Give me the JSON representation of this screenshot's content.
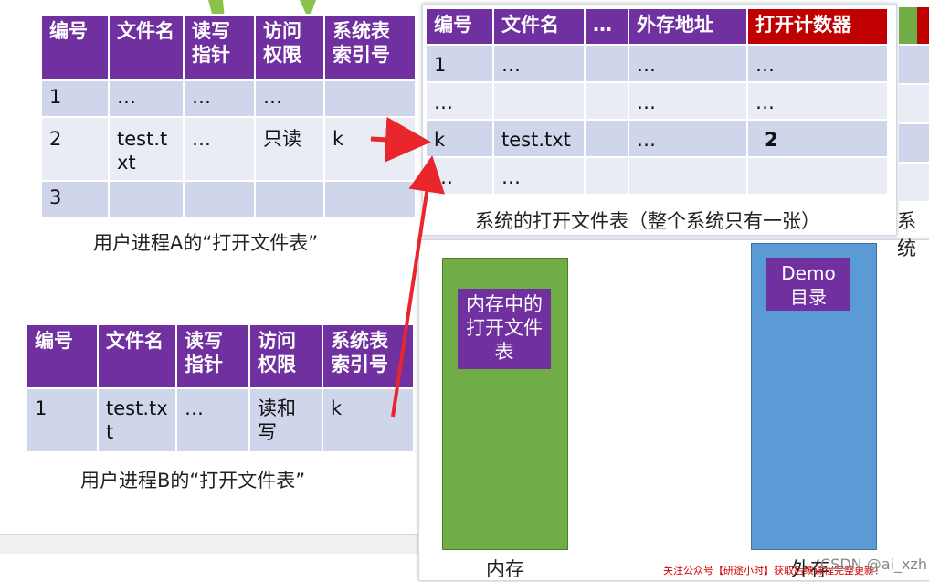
{
  "table_a": {
    "headers": [
      "编号",
      "文件名",
      "读写指针",
      "访问权限",
      "系统表索引号"
    ],
    "rows": [
      [
        "1",
        "…",
        "…",
        "…",
        ""
      ],
      [
        "2",
        "test.txt",
        "…",
        "只读",
        "k"
      ],
      [
        "3",
        "",
        "",
        "",
        ""
      ]
    ],
    "caption": "用户进程A的“打开文件表”"
  },
  "table_b": {
    "headers": [
      "编号",
      "文件名",
      "读写指针",
      "访问权限",
      "系统表索引号"
    ],
    "rows": [
      [
        "1",
        "test.txt",
        "…",
        "读和写",
        "k"
      ]
    ],
    "caption": "用户进程B的“打开文件表”"
  },
  "sys_table": {
    "headers": [
      "编号",
      "文件名",
      "…",
      "外存地址",
      "打开计数器"
    ],
    "rows": [
      [
        "1",
        "…",
        "",
        "…",
        "…"
      ],
      [
        "…",
        "",
        "",
        "…",
        "…"
      ],
      [
        "k",
        "test.txt",
        "",
        "…",
        "2"
      ],
      [
        "…",
        "…",
        "",
        "",
        ""
      ]
    ],
    "caption": "系统的打开文件表（整个系统只有一张）",
    "caption_cut": "系统"
  },
  "memory": {
    "box_label": "内存中的打开文件表",
    "label": "内存"
  },
  "storage": {
    "box_label": "Demo 目录",
    "label": "外存"
  },
  "footer": {
    "watermark": "关注公众号【研途小时】获取后续课程完整更新！",
    "csdn": "CSDN @ai_xzh"
  },
  "colors": {
    "header_purple": "#7030a0",
    "header_green": "#70ad47",
    "header_red": "#c00000",
    "row_dark": "#cfd5ea",
    "row_light": "#e9ebf5",
    "arrow_red": "#e8262b",
    "memory_green": "#70ad47",
    "storage_blue": "#5b9bd5"
  }
}
